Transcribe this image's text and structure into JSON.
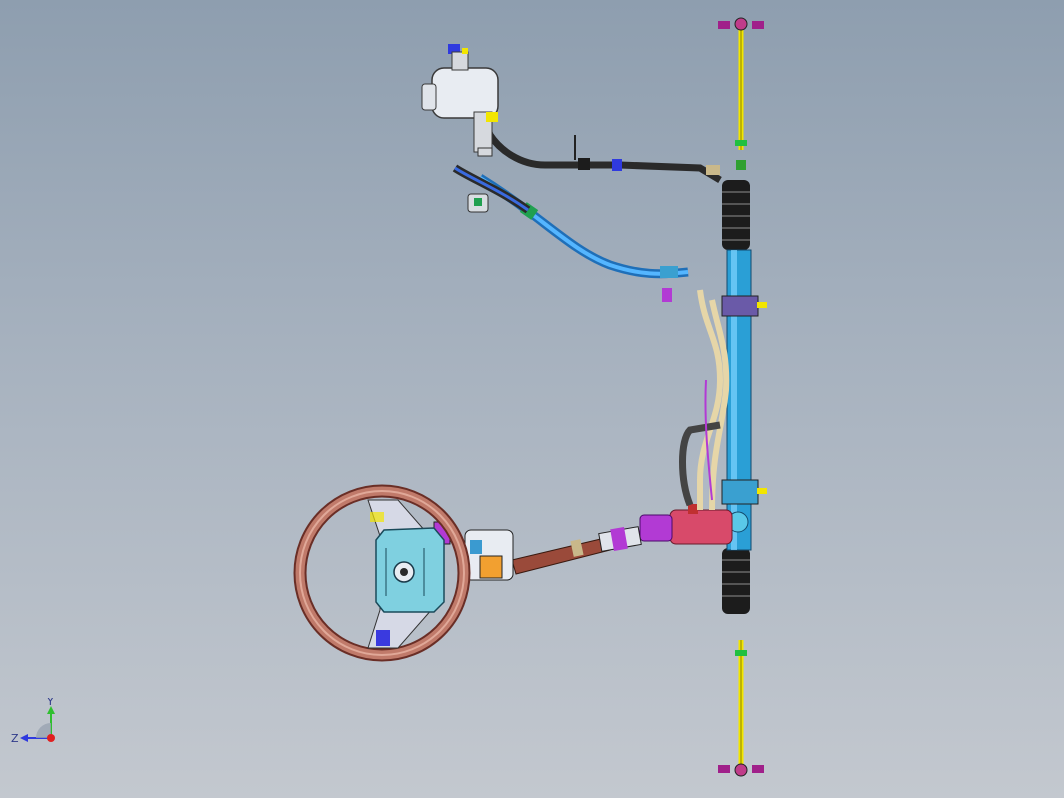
{
  "viewport": {
    "background_top": "#8e9eaf",
    "background_bottom": "#c3c8cf"
  },
  "model": {
    "components": [
      "steering-wheel",
      "airbag-module",
      "steering-column",
      "intermediate-shaft",
      "steering-gear-valve",
      "steering-rack",
      "rack-boot-upper",
      "rack-boot-lower",
      "tie-rod-upper",
      "tie-rod-lower",
      "power-steering-reservoir",
      "pressure-hose",
      "return-hose",
      "supply-hose",
      "hydraulic-lines"
    ],
    "colors": {
      "steering_wheel": "#b06a5c",
      "airbag": "#7fd0e0",
      "rack": "#2a9fd6",
      "boot": "#1c1c1c",
      "tie_rod": "#f2e600",
      "valve": "#d84a6a",
      "supply_hose": "#2b8fe8",
      "hydraulic_line": "#e6d6a8",
      "accent_magenta": "#b23ad4"
    }
  },
  "triad": {
    "y_label": "Y",
    "z_label": "Z",
    "y_axis_color": "#2fbf2f",
    "z_axis_color": "#2f3adf",
    "origin_color": "#e02020"
  }
}
